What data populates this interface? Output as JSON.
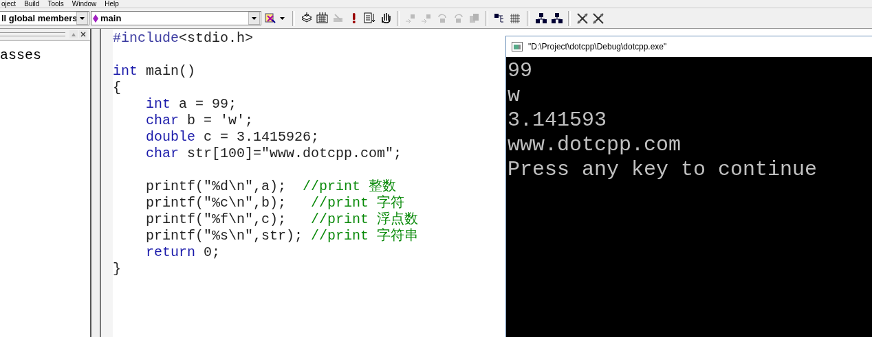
{
  "menu_bar": {
    "items": [
      "oject",
      "Build",
      "Tools",
      "Window",
      "Help"
    ]
  },
  "toolbar": {
    "scope_combo": {
      "value": "ll global members"
    },
    "function_combo": {
      "value": "main"
    },
    "buttons": [
      {
        "kind": "wizard",
        "disabled": false
      },
      {
        "kind": "sep"
      },
      {
        "kind": "compile",
        "disabled": false
      },
      {
        "kind": "build",
        "disabled": false
      },
      {
        "kind": "stop",
        "disabled": true
      },
      {
        "kind": "execute",
        "disabled": false
      },
      {
        "kind": "sort",
        "disabled": false
      },
      {
        "kind": "hand",
        "disabled": false
      },
      {
        "kind": "sep"
      },
      {
        "kind": "step",
        "disabled": true
      },
      {
        "kind": "step",
        "disabled": true
      },
      {
        "kind": "undo",
        "disabled": true
      },
      {
        "kind": "redo",
        "disabled": true
      },
      {
        "kind": "copy",
        "disabled": true
      },
      {
        "kind": "sep"
      },
      {
        "kind": "tree",
        "disabled": false
      },
      {
        "kind": "grid",
        "disabled": false
      },
      {
        "kind": "sep"
      },
      {
        "kind": "network",
        "disabled": false
      },
      {
        "kind": "network",
        "disabled": false
      },
      {
        "kind": "sep"
      },
      {
        "kind": "cross",
        "disabled": false
      },
      {
        "kind": "cross",
        "disabled": false
      }
    ]
  },
  "workspace": {
    "item": "asses"
  },
  "editor": {
    "lines": [
      {
        "parts": [
          {
            "kind": "preproc",
            "text": "#include"
          },
          {
            "kind": "plain",
            "text": "<stdio.h>"
          }
        ]
      },
      {
        "gap_before": true,
        "parts": [
          {
            "kind": "keyword",
            "text": "int"
          },
          {
            "kind": "plain",
            "text": " main()"
          }
        ]
      },
      {
        "parts": [
          {
            "kind": "plain",
            "text": "{"
          }
        ],
        "children": [
          {
            "parts": [
              {
                "kind": "keyword",
                "text": "int"
              },
              {
                "kind": "plain",
                "text": " a = 99;"
              }
            ]
          },
          {
            "parts": [
              {
                "kind": "keyword",
                "text": "char"
              },
              {
                "kind": "plain",
                "text": " b = 'w';"
              }
            ]
          },
          {
            "parts": [
              {
                "kind": "keyword",
                "text": "double"
              },
              {
                "kind": "plain",
                "text": " c = 3.1415926;"
              }
            ]
          },
          {
            "parts": [
              {
                "kind": "keyword",
                "text": "char"
              },
              {
                "kind": "plain",
                "text": " str[100]=\"www.dotcpp.com\";"
              }
            ]
          },
          {
            "gap_before": true,
            "parts": [
              {
                "kind": "plain",
                "text": "printf(\"%d\\n\",a);  "
              },
              {
                "kind": "comment",
                "text": "//print 整数"
              }
            ]
          },
          {
            "parts": [
              {
                "kind": "plain",
                "text": "printf(\"%c\\n\",b);   "
              },
              {
                "kind": "comment",
                "text": "//print 字符"
              }
            ]
          },
          {
            "parts": [
              {
                "kind": "plain",
                "text": "printf(\"%f\\n\",c);   "
              },
              {
                "kind": "comment",
                "text": "//print 浮点数"
              }
            ]
          },
          {
            "parts": [
              {
                "kind": "plain",
                "text": "printf(\"%s\\n\",str); "
              },
              {
                "kind": "comment",
                "text": "//print 字符串"
              }
            ]
          },
          {
            "parts": [
              {
                "kind": "keyword",
                "text": "return"
              },
              {
                "kind": "plain",
                "text": " 0;"
              }
            ]
          }
        ]
      },
      {
        "parts": [
          {
            "kind": "plain",
            "text": "}"
          }
        ]
      }
    ]
  },
  "console": {
    "title": "\"D:\\Project\\dotcpp\\Debug\\dotcpp.exe\"",
    "lines": [
      "99",
      "w",
      "3.141593",
      "www.dotcpp.com",
      "Press any key to continue"
    ]
  }
}
